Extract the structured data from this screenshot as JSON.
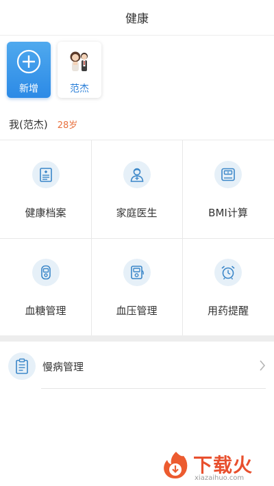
{
  "header": {
    "title": "健康"
  },
  "profiles": {
    "add_label": "新增",
    "member_label": "范杰"
  },
  "me": {
    "name": "我(范杰)",
    "age": "28岁"
  },
  "grid": [
    {
      "label": "健康档案",
      "icon": "health-record-icon"
    },
    {
      "label": "家庭医生",
      "icon": "doctor-icon"
    },
    {
      "label": "BMI计算",
      "icon": "scale-icon"
    },
    {
      "label": "血糖管理",
      "icon": "glucose-meter-icon"
    },
    {
      "label": "血压管理",
      "icon": "blood-pressure-icon"
    },
    {
      "label": "用药提醒",
      "icon": "alarm-clock-icon"
    }
  ],
  "chronic": {
    "label": "慢病管理",
    "icon": "clipboard-icon"
  },
  "watermark": {
    "title": "下载火",
    "subtitle": "xiazaihuo.com"
  },
  "colors": {
    "accent": "#2c8ae6",
    "age": "#e8703d",
    "icon_bg": "#e6f0f8",
    "icon_stroke": "#3a86c8",
    "watermark": "#e8502e"
  }
}
